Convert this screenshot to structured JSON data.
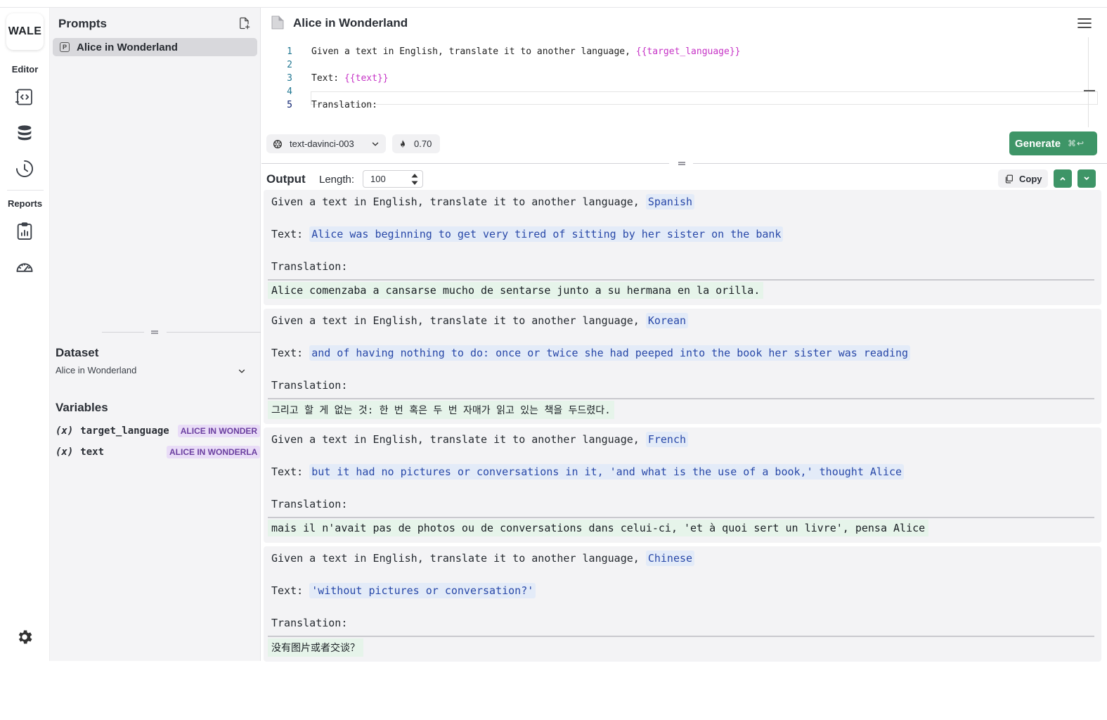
{
  "rail": {
    "logo": "WALE",
    "editor_label": "Editor",
    "reports_label": "Reports"
  },
  "sidebar": {
    "title": "Prompts",
    "prompts": [
      {
        "label": "Alice in Wonderland",
        "icon_letter": "P"
      }
    ],
    "dataset": {
      "title": "Dataset",
      "selected": "Alice in Wonderland"
    },
    "variables": {
      "title": "Variables",
      "items": [
        {
          "prefix": "(x)",
          "name": "target_language",
          "badge": "ALICE IN WONDER"
        },
        {
          "prefix": "(x)",
          "name": "text",
          "badge": "ALICE IN WONDERLA"
        }
      ]
    }
  },
  "main": {
    "title": "Alice in Wonderland",
    "editor": {
      "lines": [
        {
          "n": "1",
          "before": "Given a text in English, translate it to another language, ",
          "var": "{{target_language}}",
          "after": ""
        },
        {
          "n": "2",
          "before": "",
          "var": "",
          "after": ""
        },
        {
          "n": "3",
          "before": "Text: ",
          "var": "{{text}}",
          "after": ""
        },
        {
          "n": "4",
          "before": "",
          "var": "",
          "after": ""
        },
        {
          "n": "5",
          "before": "Translation:",
          "var": "",
          "after": ""
        }
      ]
    },
    "model": "text-davinci-003",
    "temperature": "0.70",
    "generate_label": "Generate",
    "generate_shortcut": "⌘↩",
    "output": {
      "title": "Output",
      "length_label": "Length:",
      "length_value": "100",
      "copy_label": "Copy"
    },
    "results": [
      {
        "instruction": "Given a text in English, translate it to another language, ",
        "language": "Spanish",
        "text_label": "Text: ",
        "text": "Alice was beginning to get very tired of sitting by her sister on the bank",
        "translation_label": "Translation:",
        "translation": "Alice comenzaba a cansarse mucho de sentarse junto a su hermana en la orilla."
      },
      {
        "instruction": "Given a text in English, translate it to another language, ",
        "language": "Korean",
        "text_label": "Text: ",
        "text": "and of having nothing to do: once or twice she had peeped into the book her sister was reading",
        "translation_label": "Translation:",
        "translation": "그리고 할 게 없는 것: 한 번 혹은 두 번 자매가 읽고 있는 책을 두드렸다."
      },
      {
        "instruction": "Given a text in English, translate it to another language, ",
        "language": "French",
        "text_label": "Text: ",
        "text": "but it had no pictures or conversations in it, 'and what is the use of a book,' thought Alice",
        "translation_label": "Translation:",
        "translation": "mais il n'avait pas de photos ou de conversations dans celui-ci, 'et à quoi sert un livre', pensa Alice"
      },
      {
        "instruction": "Given a text in English, translate it to another language, ",
        "language": "Chinese",
        "text_label": "Text: ",
        "text": "'without pictures or conversation?'",
        "translation_label": "Translation:",
        "translation": "没有图片或者交谈？"
      }
    ]
  },
  "colors": {
    "accent_green": "#3e9567",
    "variable_magenta": "#c633c6",
    "highlight_blue_bg": "#e3ebf8",
    "generated_green_bg": "#e6f4ea",
    "badge_purple_bg": "#e9dcf7"
  },
  "icons": [
    "editor-code-icon",
    "database-icon",
    "history-clock-icon",
    "report-chart-icon",
    "speedometer-icon",
    "settings-gear-icon",
    "new-file-icon",
    "document-icon",
    "hamburger-menu-icon",
    "openai-model-icon",
    "flame-icon",
    "copy-icon",
    "chevron-up-icon",
    "chevron-down-icon"
  ]
}
